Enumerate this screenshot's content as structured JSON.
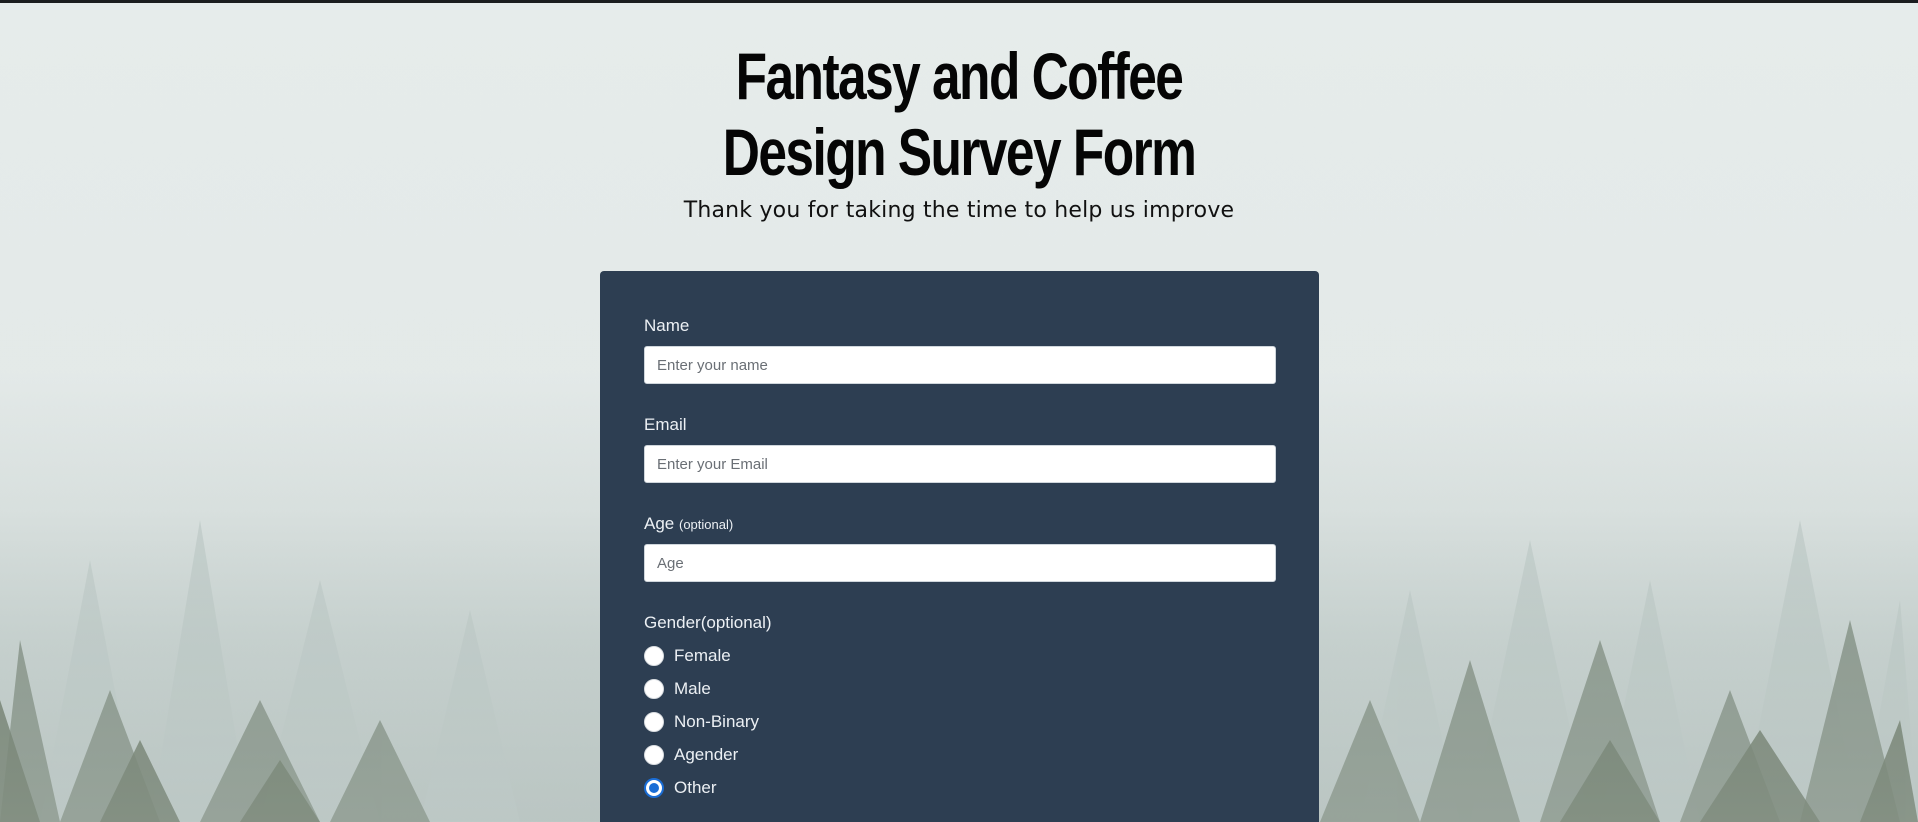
{
  "page": {
    "title": "Fantasy and Coffee Design Survey Form",
    "description": "Thank you for taking the time to help us improve"
  },
  "form": {
    "name": {
      "label": "Name",
      "placeholder": "Enter your name",
      "value": ""
    },
    "email": {
      "label": "Email",
      "placeholder": "Enter your Email",
      "value": ""
    },
    "age": {
      "label": "Age",
      "label_note": "(optional)",
      "placeholder": "Age",
      "value": ""
    },
    "gender": {
      "label": "Gender(optional)",
      "options": [
        {
          "label": "Female",
          "checked": false
        },
        {
          "label": "Male",
          "checked": false
        },
        {
          "label": "Non-Binary",
          "checked": false
        },
        {
          "label": "Agender",
          "checked": false
        },
        {
          "label": "Other",
          "checked": true
        }
      ],
      "selected": "Other"
    }
  },
  "colors": {
    "form_background": "#2d3e52",
    "radio_accent": "#1a6dd6",
    "top_bar": "#1b1d1f"
  }
}
